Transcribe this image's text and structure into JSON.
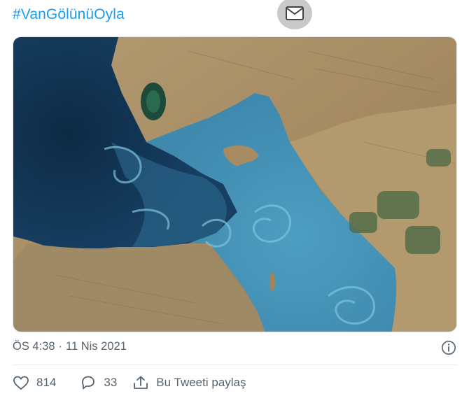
{
  "tweet": {
    "hashtag": "#VanGölünüOyla",
    "time": "ÖS 4:38",
    "separator": "·",
    "date": "11 Nis 2021"
  },
  "photo": {
    "alt": "Satellite image of Lake Van with turquoise algae swirls"
  },
  "actions": {
    "like_count": "814",
    "reply_count": "33",
    "share_label": "Bu Tweeti paylaş"
  },
  "icons": {
    "top": "mail-icon",
    "info": "info-icon",
    "like": "heart-icon",
    "reply": "reply-icon",
    "share": "share-icon"
  },
  "colors": {
    "accent": "#1d9bf0",
    "secondary_text": "#536471"
  }
}
